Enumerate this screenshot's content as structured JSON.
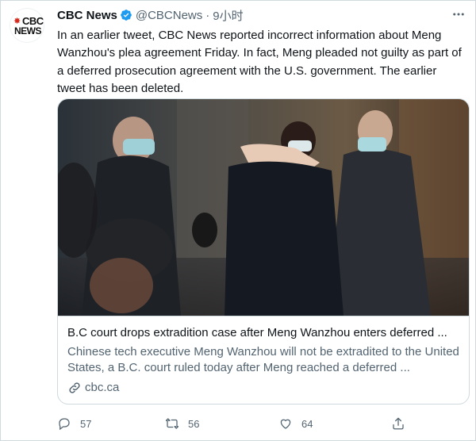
{
  "tweet": {
    "author": {
      "name": "CBC News",
      "handle": "@CBCNews",
      "avatar_logo_top": "CBC",
      "avatar_logo_bottom": "NEWS",
      "avatar_icon": "cbc-gem-icon"
    },
    "separator": "·",
    "time": "9小时",
    "more_icon": "more-options-icon",
    "text": "In an earlier tweet, CBC News reported incorrect information about Meng Wanzhou's plea agreement Friday. In fact, Meng pleaded not guilty as part of a deferred prosecution agreement with the U.S. government. The earlier tweet has been deleted.",
    "card": {
      "title": "B.C court drops extradition case after Meng Wanzhou enters deferred ...",
      "description": "Chinese tech executive Meng Wanzhou will not be extradited to the United States, a B.C. court ruled today after Meng reached a deferred ...",
      "domain": "cbc.ca",
      "image_icon": "news-photo"
    },
    "actions": {
      "reply_count": "57",
      "retweet_count": "56",
      "like_count": "64"
    }
  },
  "colors": {
    "text": "#0f1419",
    "secondary": "#536471",
    "border": "#cfd9de",
    "verified": "#1d9bf0",
    "brand_red": "#d52b1e"
  }
}
